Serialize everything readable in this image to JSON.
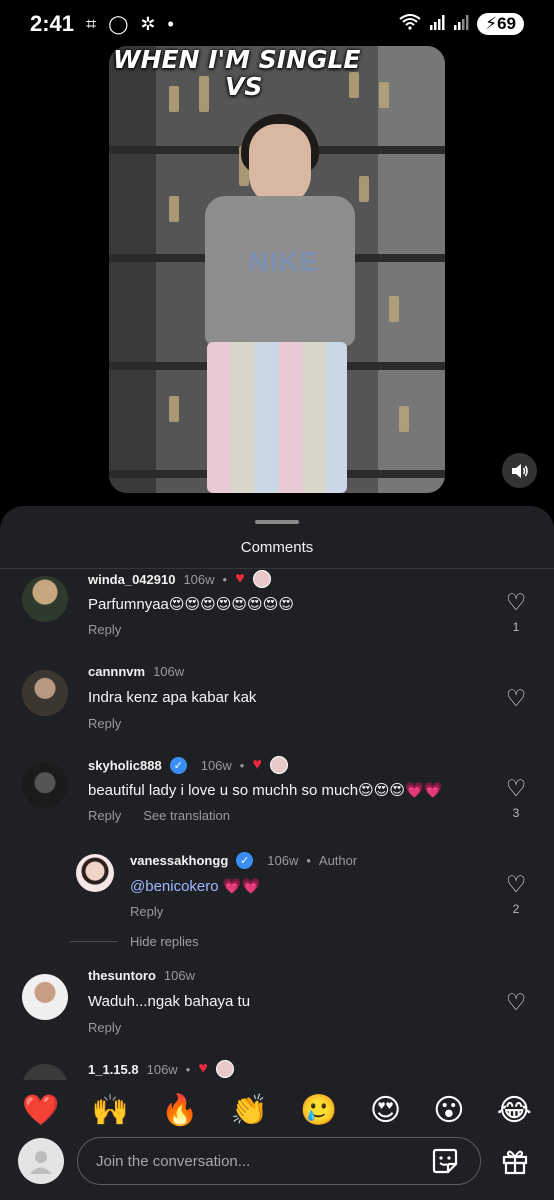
{
  "status_bar": {
    "time": "2:41",
    "battery": "69"
  },
  "video": {
    "caption_line1": "WHEN I'M SINGLE",
    "caption_line2": "VS",
    "shirt_text": "NIKE"
  },
  "sheet": {
    "title": "Comments"
  },
  "comments": [
    {
      "user": "winda_042910",
      "time": "106w",
      "text": "Parfumnyaa😍😍😍😍😍😍😍😍",
      "reply": "Reply",
      "likes": "1",
      "creator_liked": true
    },
    {
      "user": "cannnvm",
      "time": "106w",
      "text": "Indra kenz apa kabar kak",
      "reply": "Reply",
      "likes": "",
      "creator_liked": false
    },
    {
      "user": "skyholic888",
      "time": "106w",
      "text": "beautiful lady i love u so muchh so much😍😍😍💗💗",
      "reply": "Reply",
      "translate": "See translation",
      "likes": "3",
      "creator_liked": true
    },
    {
      "user": "vanessakhongg",
      "time": "106w",
      "author": "Author",
      "mention": "@benicokero",
      "text": " 💗💗",
      "reply": "Reply",
      "likes": "2"
    },
    {
      "user": "thesuntoro",
      "time": "106w",
      "text": "Waduh...ngak bahaya tu",
      "reply": "Reply",
      "likes": ""
    },
    {
      "user": "1_1.15.8",
      "time": "106w",
      "creator_liked": true
    }
  ],
  "hide_replies": "Hide replies",
  "emoji_bar": [
    "❤️",
    "🙌",
    "🔥",
    "👏",
    "🥲",
    "😍",
    "😮",
    "😂"
  ],
  "input": {
    "placeholder": "Join the conversation..."
  },
  "icons": {
    "heart": "heart-outline-icon",
    "volume": "speaker-icon",
    "sticker": "sticker-icon",
    "gift": "gift-icon"
  }
}
